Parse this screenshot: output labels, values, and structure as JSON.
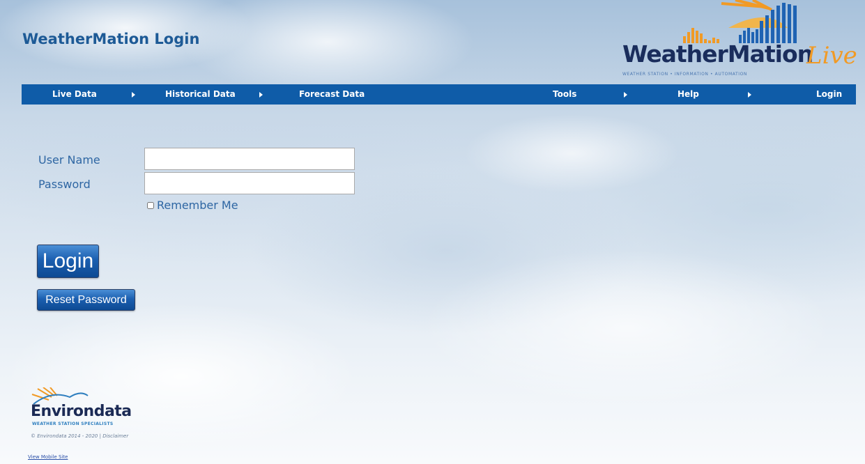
{
  "page": {
    "title": "WeatherMation Login"
  },
  "logo": {
    "word": "WeatherMation",
    "live": "Live",
    "tagline": "WEATHER STATION • INFORMATION • AUTOMATION"
  },
  "nav": {
    "items": [
      {
        "label": "Live Data",
        "has_submenu": true
      },
      {
        "label": "Historical Data",
        "has_submenu": true
      },
      {
        "label": "Forecast Data",
        "has_submenu": false
      },
      {
        "label": "Tools",
        "has_submenu": true
      },
      {
        "label": "Help",
        "has_submenu": true
      },
      {
        "label": "Login",
        "has_submenu": false
      }
    ]
  },
  "form": {
    "username_label": "User Name",
    "username_value": "",
    "password_label": "Password",
    "password_value": "",
    "remember_label": "Remember Me",
    "remember_checked": false,
    "login_button": "Login",
    "reset_button": "Reset Password"
  },
  "footer": {
    "logo_word": "Environdata",
    "logo_tagline": "WEATHER STATION SPECIALISTS",
    "copyright": "© Environdata 2014 - 2020",
    "separator": "|",
    "disclaimer": "Disclaimer",
    "mobile_link": "View Mobile Site"
  },
  "colors": {
    "nav_bg": "#0f5ca8",
    "title": "#1d5a96",
    "label": "#2e66a3",
    "button": "#1b5fb0",
    "accent_orange": "#f19a25"
  }
}
